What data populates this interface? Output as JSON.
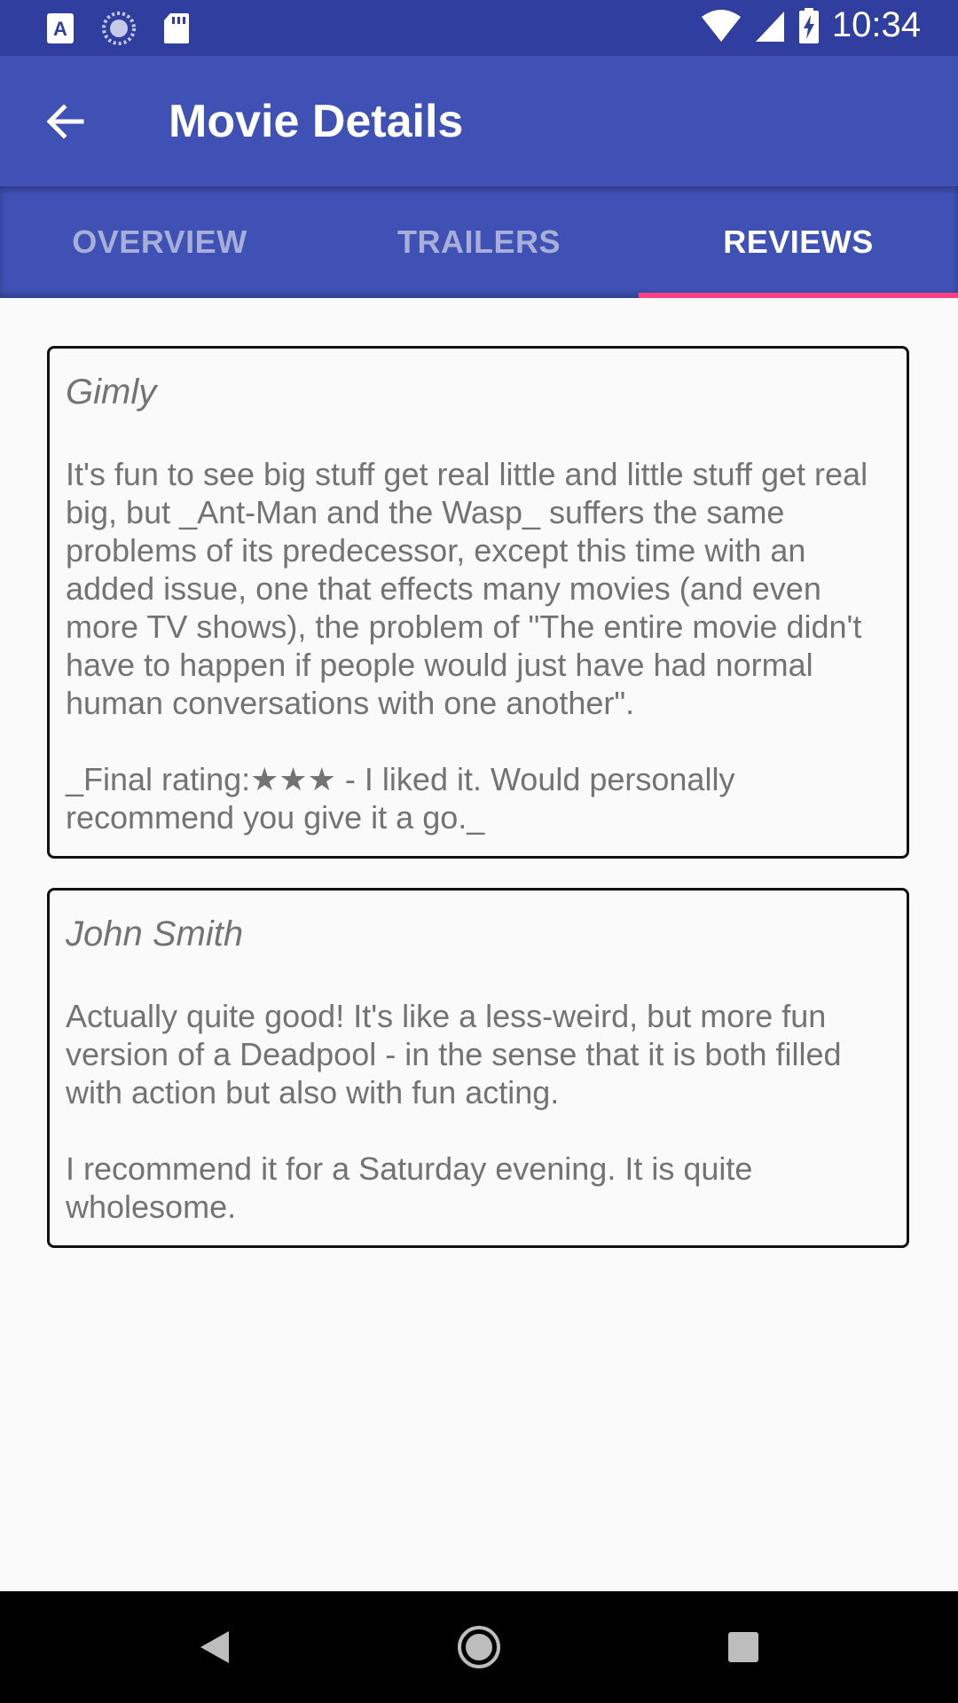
{
  "status_bar": {
    "time": "10:34",
    "icons": [
      "text-a-icon",
      "loading-icon",
      "sd-card-icon",
      "wifi-icon",
      "signal-icon",
      "battery-charging-icon"
    ],
    "bg_color": "#303f9f"
  },
  "app_bar": {
    "title": "Movie Details",
    "back_icon": "arrow-back-icon",
    "bg_color": "#3f51b5"
  },
  "tabs": {
    "items": [
      {
        "label": "OVERVIEW",
        "active": false
      },
      {
        "label": "TRAILERS",
        "active": false
      },
      {
        "label": "REVIEWS",
        "active": true
      }
    ],
    "indicator_color": "#ff4081"
  },
  "reviews": [
    {
      "author": "Gimly",
      "content": "It's fun to see big stuff get real little and little stuff get real big, but _Ant-Man and the Wasp_ suffers the same problems of its predecessor, except this time with an added issue, one that effects many movies (and even more TV shows), the problem of \"The entire movie didn't have to happen if people would just have had normal human conversations with one another\".\n\n_Final rating:★★★ - I liked it. Would personally recommend you give it a go._"
    },
    {
      "author": "John Smith",
      "content": "Actually quite good! It's like a less-weird, but more fun version of a Deadpool - in the sense that it is both filled with action but also with fun acting.\n\nI recommend it for a Saturday evening. It is quite wholesome."
    }
  ],
  "nav_bar": {
    "buttons": [
      "back-triangle-icon",
      "home-circle-icon",
      "recents-square-icon"
    ]
  }
}
